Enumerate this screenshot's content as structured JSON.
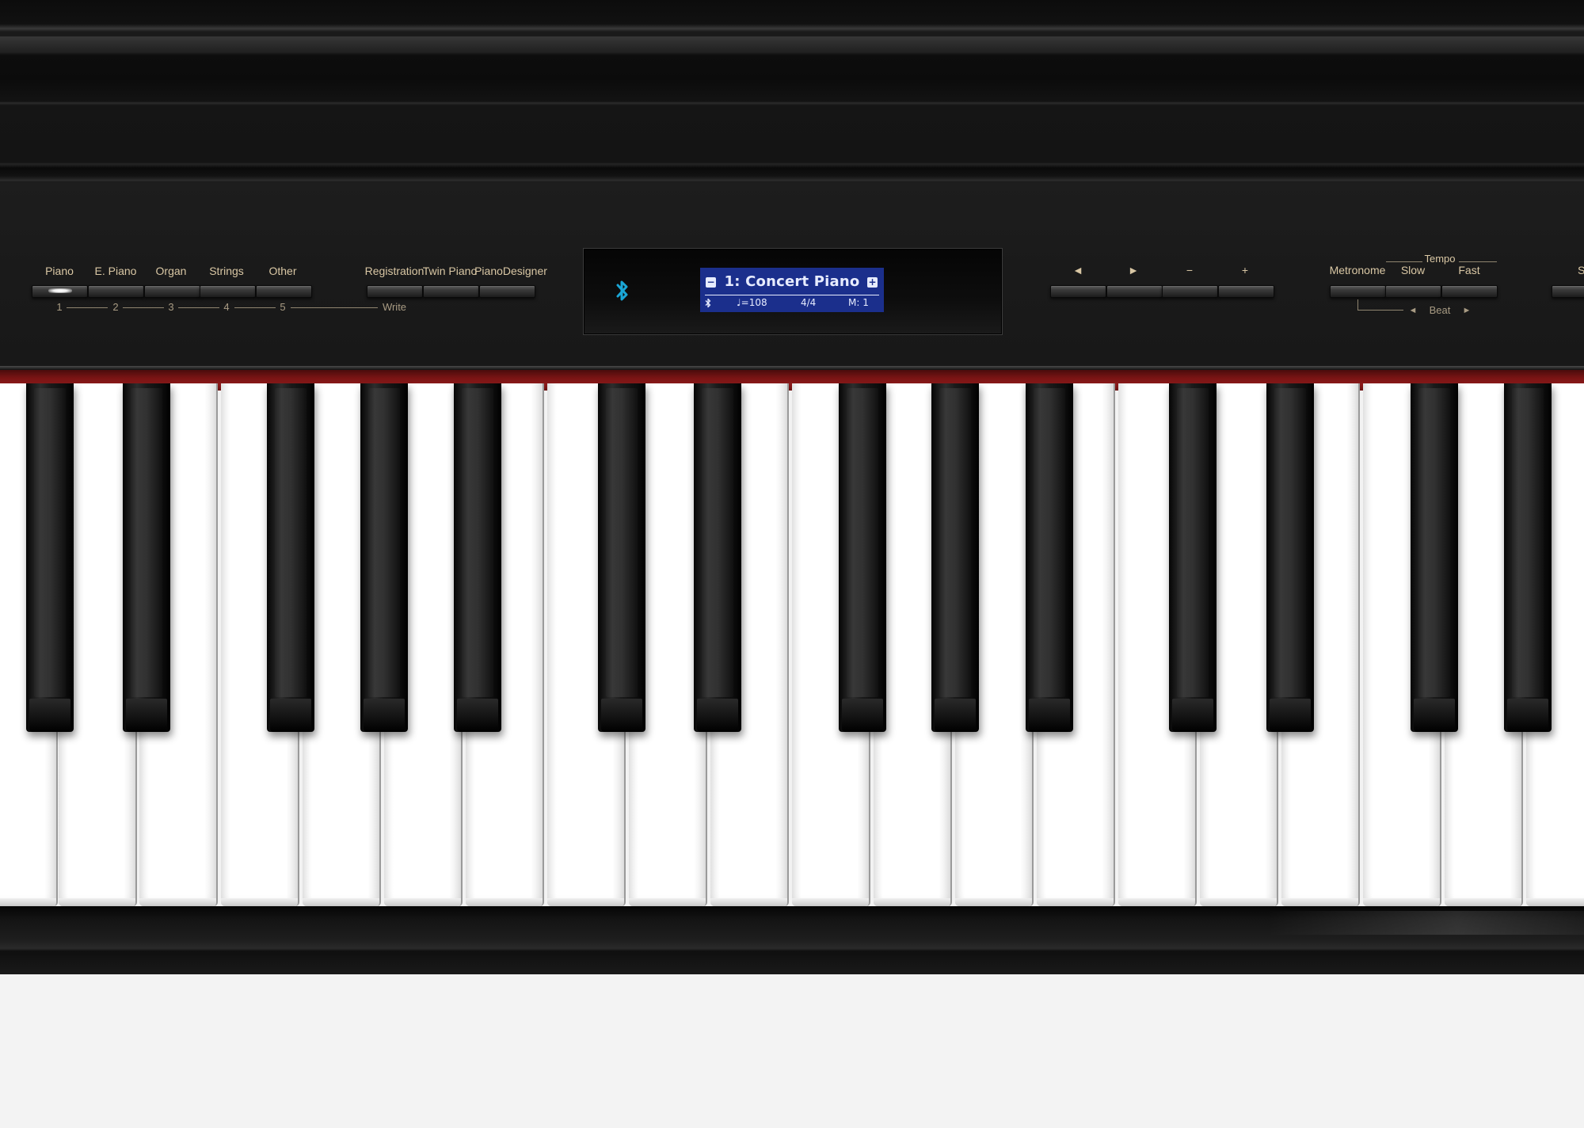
{
  "tone_buttons": {
    "labels": [
      "Piano",
      "E. Piano",
      "Organ",
      "Strings",
      "Other"
    ],
    "numbers": [
      "1",
      "2",
      "3",
      "4",
      "5"
    ]
  },
  "registration_buttons": {
    "labels": [
      "Registration",
      "Twin Piano",
      "PianoDesigner"
    ],
    "write_label": "Write"
  },
  "display": {
    "tone_name": "1: Concert Piano",
    "minus_symbol": "−",
    "plus_symbol": "+",
    "tempo": "♩=108",
    "time_signature": "4/4",
    "measure": "M: 1",
    "bluetooth_color": "#1aa6d6",
    "lcd_color": "#1b2f8c"
  },
  "transport_buttons": {
    "labels": [
      "◄",
      "►",
      "−",
      "+"
    ]
  },
  "tempo_group": {
    "labels": [
      "Metronome",
      "Slow",
      "Fast"
    ],
    "tempo_label": "Tempo",
    "beat_label": "Beat",
    "beat_left": "◄",
    "beat_right": "►"
  },
  "cut_off_label": "Son",
  "colors": {
    "panel_text": "#d9c7a4",
    "felt": "#8b1a1a",
    "body": "#1a1a1a"
  }
}
